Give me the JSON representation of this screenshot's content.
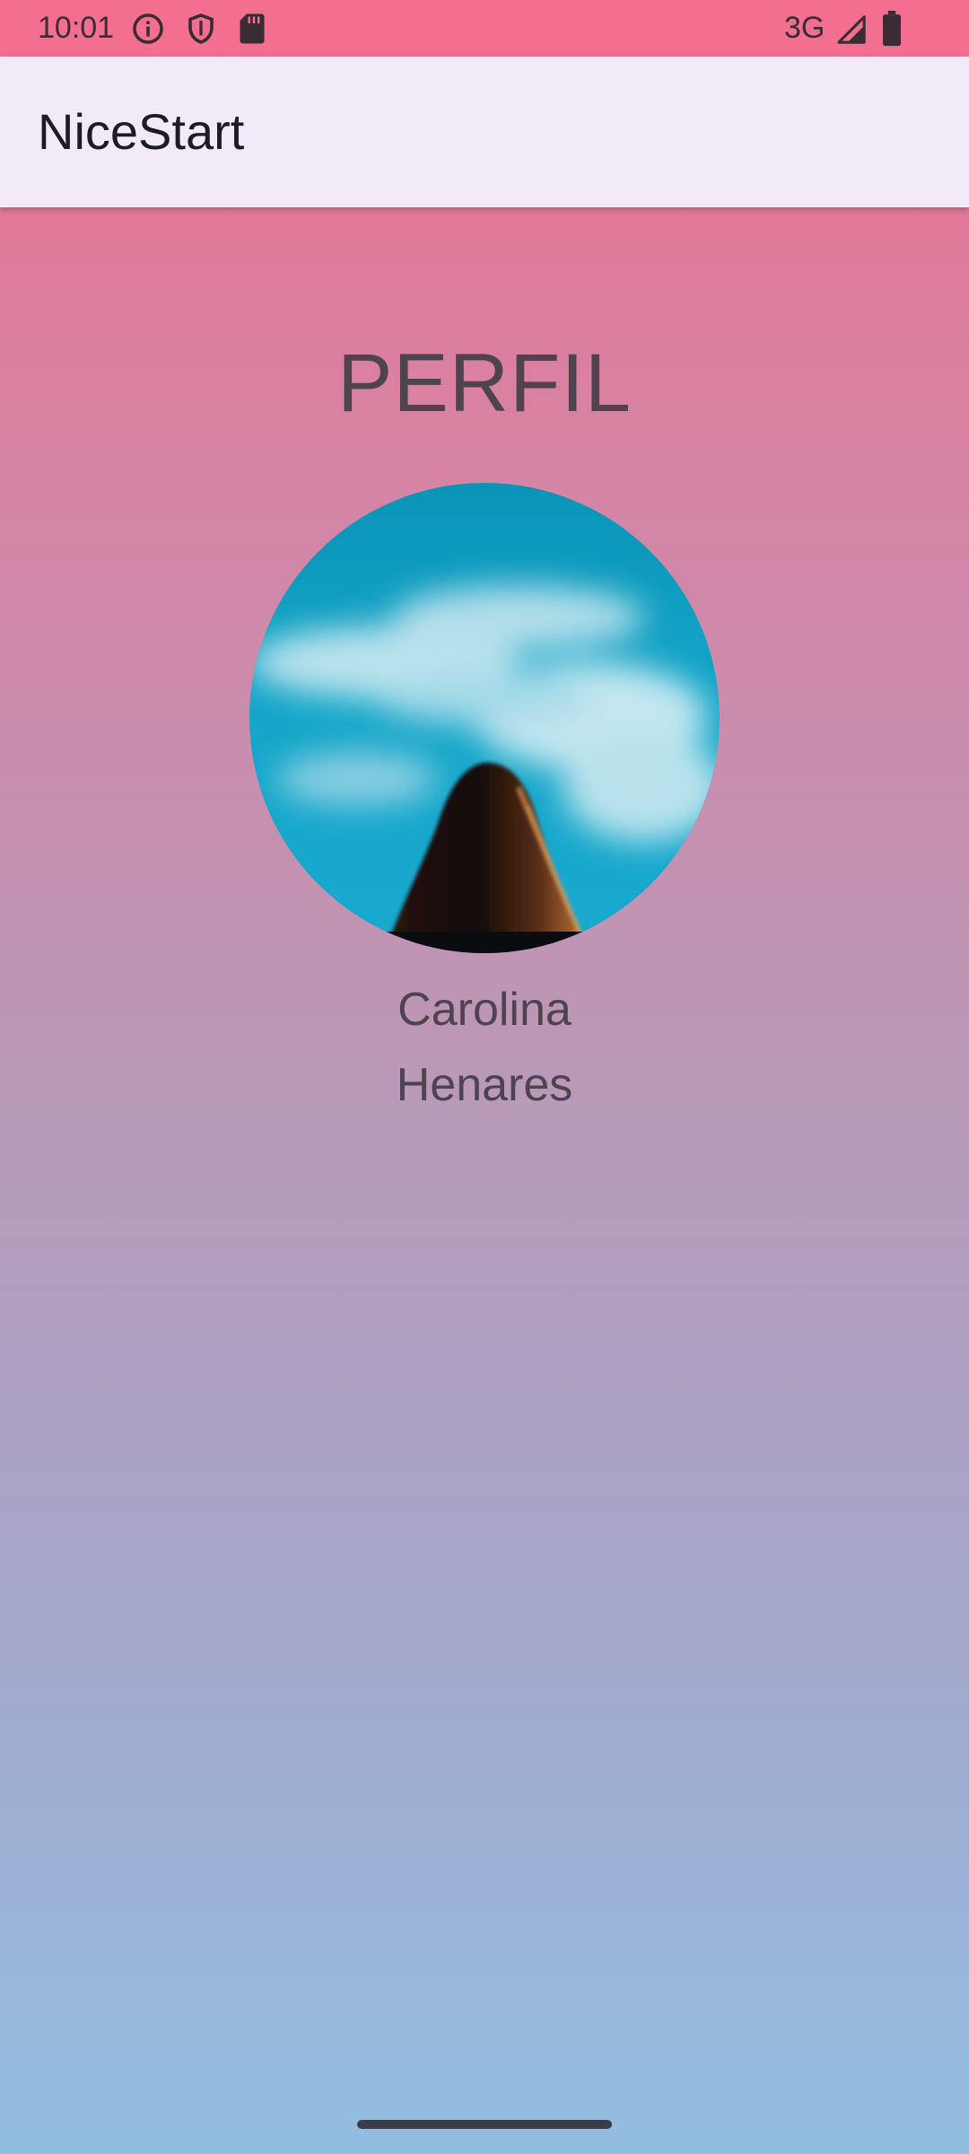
{
  "status_bar": {
    "time": "10:01",
    "network": "3G",
    "icons": [
      "info-icon",
      "shield-icon",
      "sd-card-icon",
      "signal-icon",
      "battery-icon"
    ]
  },
  "app_bar": {
    "title": "NiceStart"
  },
  "profile": {
    "heading": "PERFIL",
    "first_name": "Carolina",
    "last_name": "Henares",
    "avatar": "profile-photo-woman-sky"
  },
  "colors": {
    "status_bar": "#f36e8f",
    "app_bar": "#f2eaf6",
    "gradient_top": "#e8708f",
    "gradient_bottom": "#92bde0",
    "text": "#4e4450"
  }
}
